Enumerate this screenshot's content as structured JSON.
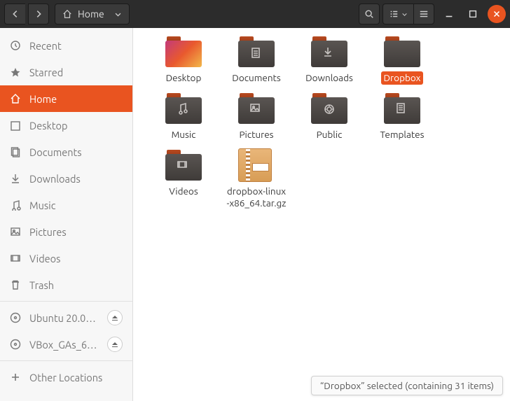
{
  "header": {
    "location_label": "Home"
  },
  "sidebar": {
    "items": [
      {
        "id": "recent",
        "label": "Recent",
        "icon": "clock"
      },
      {
        "id": "starred",
        "label": "Starred",
        "icon": "star"
      },
      {
        "id": "home",
        "label": "Home",
        "icon": "home",
        "active": true
      },
      {
        "id": "desktop",
        "label": "Desktop",
        "icon": "desktop"
      },
      {
        "id": "documents",
        "label": "Documents",
        "icon": "documents"
      },
      {
        "id": "downloads",
        "label": "Downloads",
        "icon": "downloads"
      },
      {
        "id": "music",
        "label": "Music",
        "icon": "music"
      },
      {
        "id": "pictures",
        "label": "Pictures",
        "icon": "pictures"
      },
      {
        "id": "videos",
        "label": "Videos",
        "icon": "videos"
      },
      {
        "id": "trash",
        "label": "Trash",
        "icon": "trash"
      }
    ],
    "volumes": [
      {
        "id": "ubuntu",
        "label": "Ubuntu 20.0…",
        "ejectable": true
      },
      {
        "id": "vbox",
        "label": "VBox_GAs_6.…",
        "ejectable": true
      }
    ],
    "other_locations_label": "Other Locations"
  },
  "main": {
    "items": [
      {
        "label": "Desktop",
        "type": "folder-desktop",
        "glyph": ""
      },
      {
        "label": "Documents",
        "type": "folder",
        "glyph": "documents"
      },
      {
        "label": "Downloads",
        "type": "folder",
        "glyph": "downloads"
      },
      {
        "label": "Dropbox",
        "type": "folder",
        "glyph": "",
        "selected": true
      },
      {
        "label": "Music",
        "type": "folder",
        "glyph": "music"
      },
      {
        "label": "Pictures",
        "type": "folder",
        "glyph": "pictures"
      },
      {
        "label": "Public",
        "type": "folder",
        "glyph": "public"
      },
      {
        "label": "Templates",
        "type": "folder",
        "glyph": "templates"
      },
      {
        "label": "Videos",
        "type": "folder",
        "glyph": "videos"
      },
      {
        "label": "dropbox-linux-x86_64.tar.gz",
        "type": "archive"
      }
    ]
  },
  "status": {
    "text": "“Dropbox” selected  (containing 31 items)"
  }
}
